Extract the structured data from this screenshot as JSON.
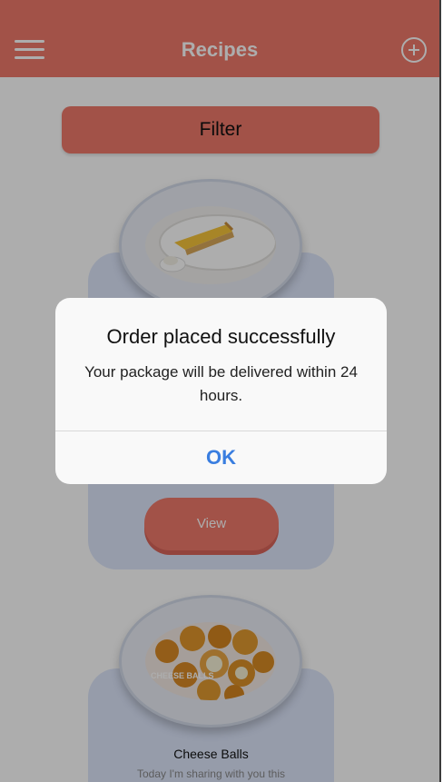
{
  "header": {
    "title": "Recipes",
    "menu_icon": "hamburger-menu-icon",
    "add_icon": "plus-circle-icon",
    "background": "#ef7a6a"
  },
  "filter": {
    "label": "Filter"
  },
  "recipes": [
    {
      "image": "lemon-tart-slice-image",
      "view_label": "View"
    },
    {
      "image": "cheese-balls-image",
      "image_caption": "CHEESE BALLS",
      "title": "Cheese Balls",
      "description": "Today I'm sharing with you this"
    }
  ],
  "alert": {
    "title": "Order placed successfully",
    "message": "Your package will be delivered within 24 hours.",
    "ok_label": "OK",
    "ok_color": "#3a7ee0"
  },
  "colors": {
    "accent": "#ef7a6a",
    "card": "#dde6fb"
  }
}
